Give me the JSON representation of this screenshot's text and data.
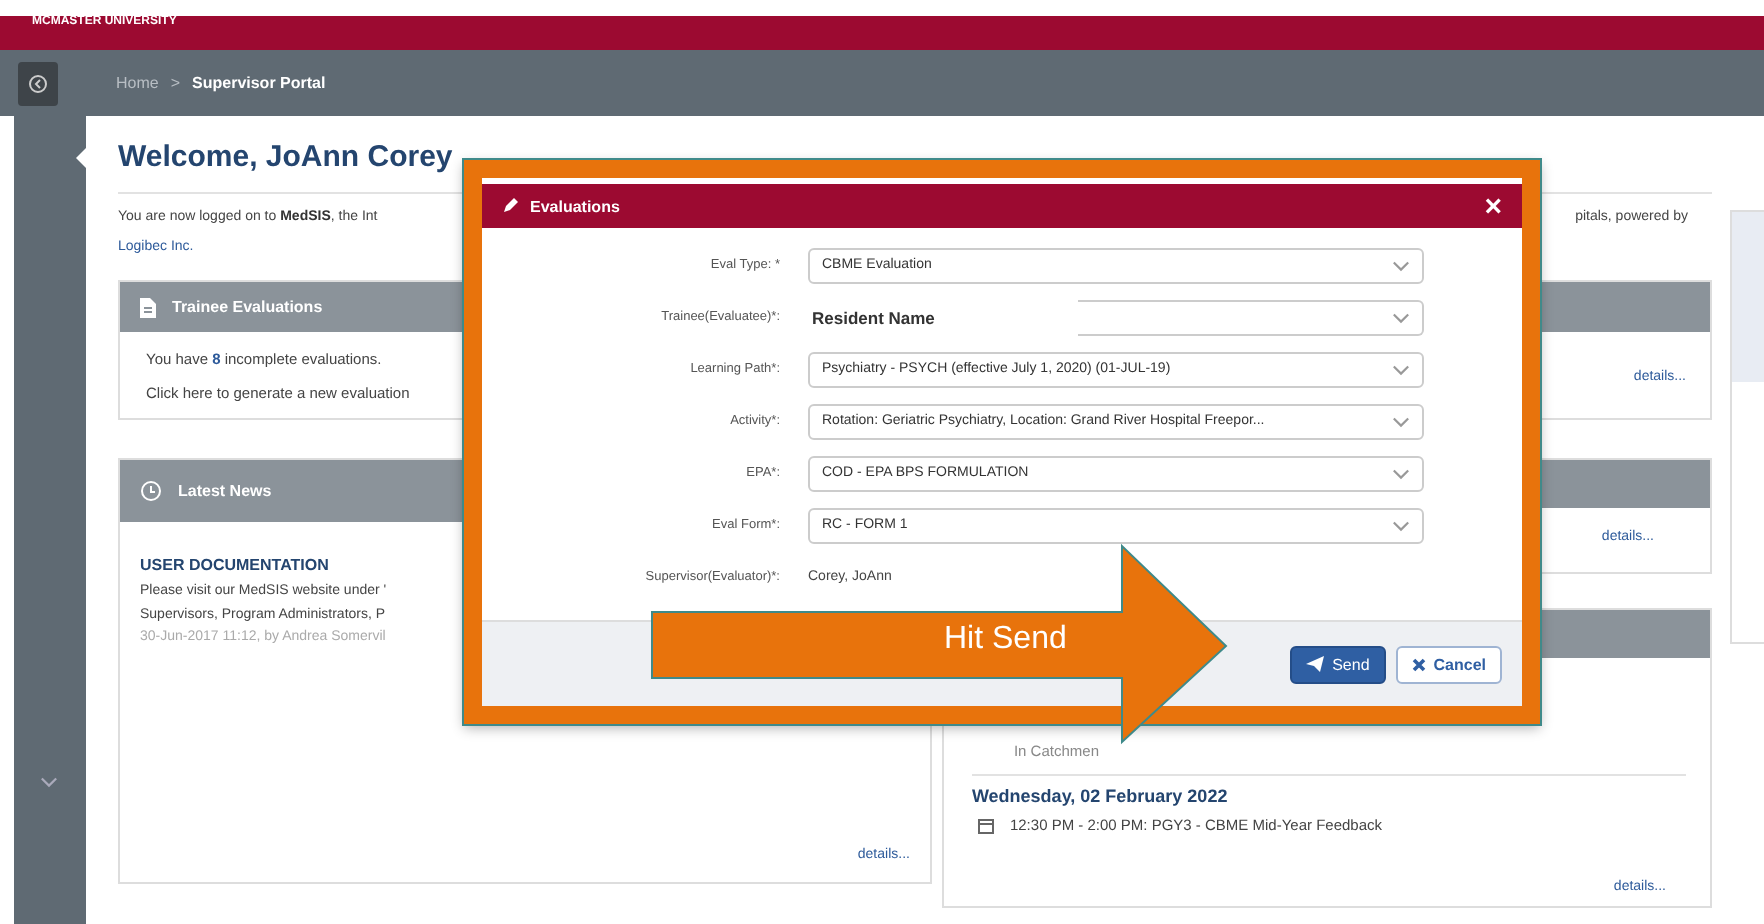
{
  "top_bar": {
    "title": "MCMASTER UNIVERSITY"
  },
  "breadcrumb": {
    "items": [
      {
        "label": "Home",
        "current": false
      },
      {
        "label": "Supervisor Portal",
        "current": true
      }
    ],
    "separator": ">"
  },
  "welcome": {
    "title": "Welcome, JoAnn Corey",
    "intro_left": "You are now logged on to **MedSIS**, the Int",
    "intro_right": "pitals, powered by",
    "intro_link": "Logibec Inc."
  },
  "trainee_panel": {
    "title": "Trainee Evaluations",
    "lines": [
      "You have **8** incomplete evaluations.",
      "Click here to generate a new evaluation"
    ],
    "link": "details..."
  },
  "news_panel": {
    "title": "Latest News",
    "item_title": "USER DOCUMENTATION",
    "lines": [
      "Please visit our MedSIS website under '",
      "Supervisors, Program Administrators, P"
    ],
    "meta": "30-Jun-2017 11:12, by Andrea Somervil",
    "link": "details..."
  },
  "side_panels": [
    {
      "link": "details..."
    },
    {
      "partial_text": "In Catchmen",
      "date": "Wednesday, 02 February 2022",
      "event": "12:30 PM - 2:00 PM: PGY3 - CBME Mid-Year Feedback",
      "link": "details..."
    }
  ],
  "modal": {
    "title": "Evaluations",
    "close": "×",
    "rows": [
      {
        "label": "Eval Type: *",
        "kind": "select",
        "value": "CBME Evaluation"
      },
      {
        "label": "Trainee(Evaluatee)*:",
        "kind": "name-select",
        "value": "Resident Name"
      },
      {
        "label": "Learning Path*:",
        "kind": "select",
        "value": "Psychiatry - PSYCH (effective July 1, 2020) (01-JUL-19)"
      },
      {
        "label": "Activity*:",
        "kind": "select",
        "value": "Rotation: Geriatric Psychiatry, Location: Grand River Hospital Freepor..."
      },
      {
        "label": "EPA*:",
        "kind": "select",
        "value": "COD - EPA BPS FORMULATION"
      },
      {
        "label": "Eval Form*:",
        "kind": "select",
        "value": "RC - FORM 1"
      },
      {
        "label": "Supervisor(Evaluator)*:",
        "kind": "text",
        "value": "Corey, JoAnn"
      }
    ],
    "buttons": [
      {
        "label": "Send",
        "kind": "primary"
      },
      {
        "label": "Cancel",
        "kind": "secondary"
      }
    ]
  },
  "callout": {
    "label": "Hit Send"
  }
}
